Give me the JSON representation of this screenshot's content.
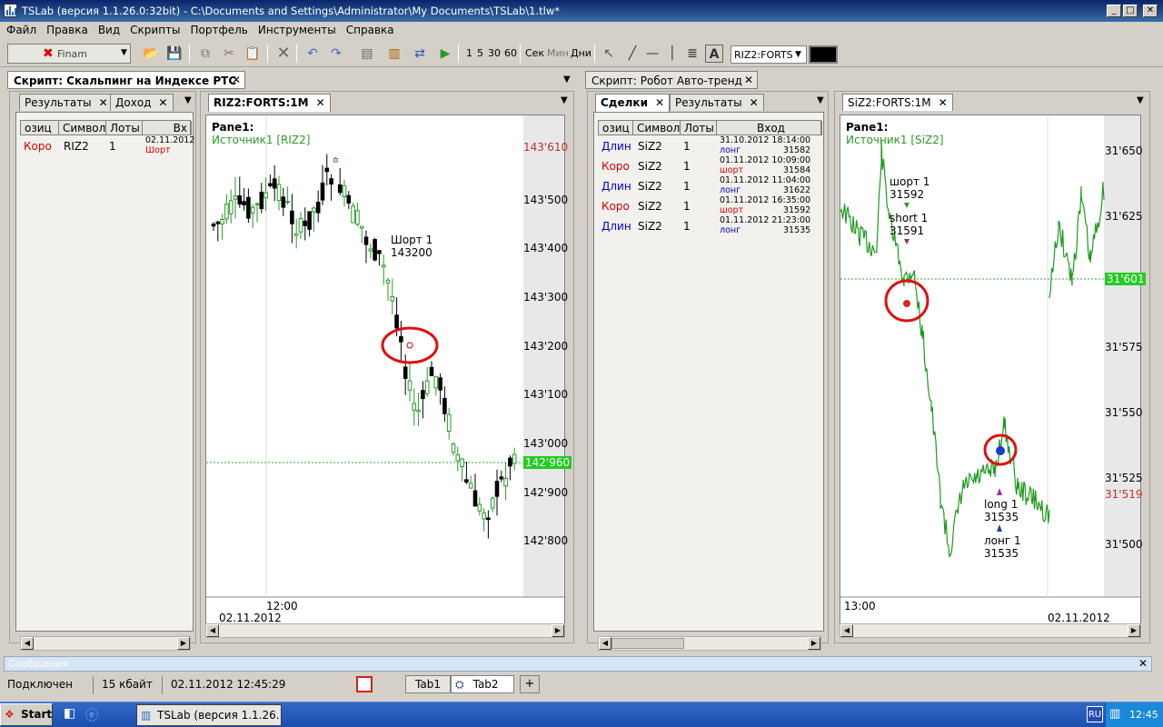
{
  "window": {
    "title": "TSLab (версия 1.1.26.0:32bit) - C:\\Documents and Settings\\Administrator\\My Documents\\TSLab\\1.tlw*"
  },
  "menu": [
    "Файл",
    "Правка",
    "Вид",
    "Скрипты",
    "Портфель",
    "Инструменты",
    "Справка"
  ],
  "toolbar": {
    "provider": "Finam",
    "timeframes": [
      "1",
      "5",
      "30",
      "60"
    ],
    "units": [
      "Сек",
      "Мин",
      "Дни"
    ],
    "symbol": "RIZ2:FORTS"
  },
  "left_script": {
    "title": "Скрипт: Скальпинг на Индексе РТС",
    "tabs": [
      "Результаты",
      "Доход"
    ],
    "columns": [
      "озиц",
      "Символ",
      "Лоты",
      "Вх"
    ],
    "rows": [
      {
        "pos": "Коро",
        "symbol": "RIZ2",
        "lots": "1",
        "date": "02.11.2012",
        "side": "Шорт"
      }
    ],
    "chart_tab": "RIZ2:FORTS:1M",
    "pane": "Pane1:",
    "source": "Источник1 [RIZ2]",
    "yticks": [
      "143'610",
      "143'500",
      "143'400",
      "143'300",
      "143'200",
      "143'100",
      "143'000",
      "142'900",
      "142'800"
    ],
    "last_price": "142'960",
    "xtick": "12:00",
    "date": "02.11.2012",
    "annotation_line1": "Шорт 1",
    "annotation_line2": "143200"
  },
  "right_script": {
    "title": "Скрипт: Робот Авто-тренд",
    "tabs": [
      "Сделки",
      "Результаты"
    ],
    "columns": [
      "озиц",
      "Символ",
      "Лоты",
      "Вход"
    ],
    "rows": [
      {
        "pos": "Длин",
        "symbol": "SiZ2",
        "lots": "1",
        "date": "31.10.2012 18:14:00",
        "side": "лонг",
        "price": "31582"
      },
      {
        "pos": "Коро",
        "symbol": "SiZ2",
        "lots": "1",
        "date": "01.11.2012 10:09:00",
        "side": "шорт",
        "price": "31584"
      },
      {
        "pos": "Длин",
        "symbol": "SiZ2",
        "lots": "1",
        "date": "01.11.2012 11:04:00",
        "side": "лонг",
        "price": "31622"
      },
      {
        "pos": "Коро",
        "symbol": "SiZ2",
        "lots": "1",
        "date": "01.11.2012 16:35:00",
        "side": "шорт",
        "price": "31592"
      },
      {
        "pos": "Длин",
        "symbol": "SiZ2",
        "lots": "1",
        "date": "01.11.2012 21:23:00",
        "side": "лонг",
        "price": "31535"
      }
    ],
    "chart_tab": "SiZ2:FORTS:1M",
    "pane": "Pane1:",
    "source": "Источник1 [SiZ2]",
    "yticks": [
      "31'650",
      "31'625",
      "31'575",
      "31'550",
      "31'525",
      "31'500"
    ],
    "last_price": "31'601",
    "low_price": "31'519",
    "xtick": "13:00",
    "date": "02.11.2012",
    "ann": [
      {
        "l1": "шорт 1",
        "l2": "31592"
      },
      {
        "l1": "short 1",
        "l2": "31591"
      },
      {
        "l1": "long 1",
        "l2": "31535"
      },
      {
        "l1": "лонг 1",
        "l2": "31535"
      }
    ]
  },
  "messages": "Сообщения",
  "status": {
    "connection": "Подключен",
    "size": "15 кбайт",
    "datetime": "02.11.2012 12:45:29",
    "tabs": [
      "Tab1",
      "Tab2"
    ],
    "add": "+"
  },
  "taskbar": {
    "start": "Start",
    "task": "TSLab (версия 1.1.26....",
    "lang": "RU",
    "clock": "12:45"
  },
  "colors": {
    "accent": "#0a246a",
    "candle_up": "#2a9a2a",
    "candle_down": "#000000",
    "price_hl": "#22cc22",
    "short_text": "#d40000",
    "long_text": "#0000c0"
  }
}
